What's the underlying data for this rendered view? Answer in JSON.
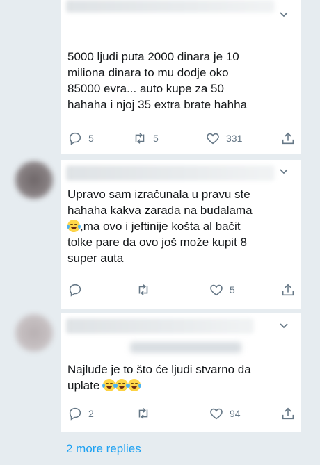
{
  "tweets": [
    {
      "text": "5000 ljudi puta 2000 dinara je 10\nmiliona dinara to mu dodje oko\n85000 evra... auto kupe za 50\nhahaha i njoj 35 extra brate hahha",
      "reply_count": "5",
      "retweet_count": "5",
      "like_count": "331"
    },
    {
      "text_before_emoji": "Upravo sam izračunala u pravu ste\nhahaha kakva zarada na budalama\n",
      "text_after_emoji": ",ma ovo i jeftinije košta al bačit\ntolke pare da ovo još može kupit 8\nsuper auta",
      "emoji": "rolling-on-floor-laughing",
      "reply_count": "",
      "retweet_count": "",
      "like_count": "5"
    },
    {
      "text": "Najluđe je to što će ljudi stvarno da\nuplate ",
      "emojis": [
        "face-with-tears-of-joy",
        "face-with-tears-of-joy",
        "face-with-tears-of-joy"
      ],
      "reply_count": "2",
      "retweet_count": "",
      "like_count": "94"
    }
  ],
  "more_replies": "2 more replies",
  "colors": {
    "background": "#e6ecf0",
    "card": "#ffffff",
    "text": "#14171a",
    "muted": "#657786",
    "link": "#1da1f2"
  },
  "icons": [
    "caret-down-icon",
    "reply-icon",
    "retweet-icon",
    "like-icon",
    "share-icon"
  ]
}
